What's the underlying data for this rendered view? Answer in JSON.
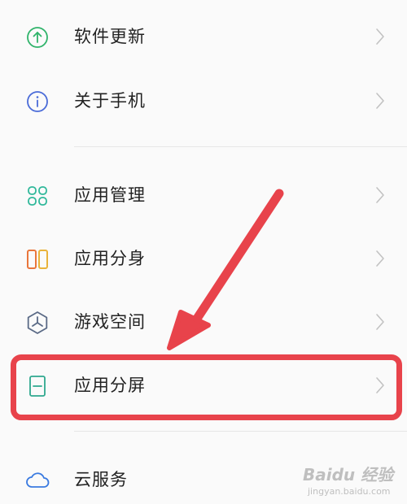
{
  "settings_list": {
    "items": [
      {
        "label": "软件更新",
        "icon": "arrow-up-circle-icon",
        "color": "#2fb36a"
      },
      {
        "label": "关于手机",
        "icon": "info-circle-icon",
        "color": "#4a6bd8"
      },
      {
        "label": "应用管理",
        "icon": "grid-apps-icon",
        "color": "#2fb89a"
      },
      {
        "label": "应用分身",
        "icon": "dual-apps-icon",
        "color": "#e9a23b"
      },
      {
        "label": "游戏空间",
        "icon": "game-space-icon",
        "color": "#5a6a86"
      },
      {
        "label": "应用分屏",
        "icon": "split-screen-icon",
        "color": "#2ea88e"
      },
      {
        "label": "云服务",
        "icon": "cloud-icon",
        "color": "#3a7ae0"
      }
    ]
  },
  "annotation": {
    "highlight_color": "#e8434b"
  },
  "watermark": {
    "main": "Baidu 经验",
    "sub": "jingyan.baidu.com"
  }
}
